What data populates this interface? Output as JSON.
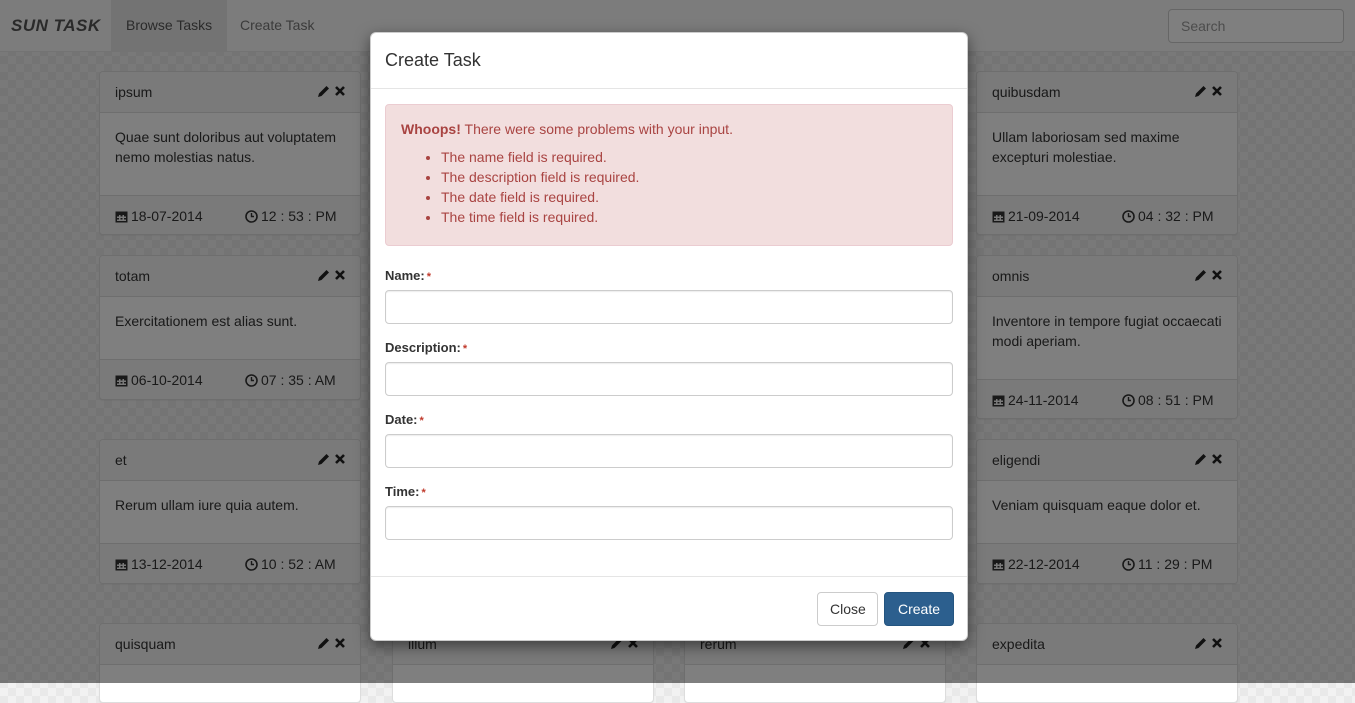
{
  "navbar": {
    "brand": "SUN TASK",
    "links": [
      {
        "label": "Browse Tasks",
        "active": true
      },
      {
        "label": "Create Task",
        "active": false
      }
    ],
    "search_placeholder": "Search"
  },
  "tasks": [
    {
      "title": "ipsum",
      "description": "Quae sunt doloribus aut voluptatem nemo molestias natus.",
      "date": "18-07-2014",
      "time": "12 : 53 : PM"
    },
    {
      "title": "quibusdam",
      "description": "Ullam laboriosam sed maxime excepturi molestiae.",
      "date": "21-09-2014",
      "time": "04 : 32 : PM"
    },
    {
      "title": "totam",
      "description": "Exercitationem est alias sunt.",
      "date": "06-10-2014",
      "time": "07 : 35 : AM"
    },
    {
      "title": "omnis",
      "description": "Inventore in tempore fugiat occaecati modi aperiam.",
      "date": "24-11-2014",
      "time": "08 : 51 : PM"
    },
    {
      "title": "et",
      "description": "Rerum ullam iure quia autem.",
      "date": "13-12-2014",
      "time": "10 : 52 : AM"
    },
    {
      "title": "eligendi",
      "description": "Veniam quisquam eaque dolor et.",
      "date": "22-12-2014",
      "time": "11 : 29 : PM"
    },
    {
      "title": "quisquam"
    },
    {
      "title": "illum"
    },
    {
      "title": "rerum"
    },
    {
      "title": "expedita"
    }
  ],
  "modal": {
    "title": "Create Task",
    "alert": {
      "strong": "Whoops!",
      "message": " There were some problems with your input.",
      "errors": [
        "The name field is required.",
        "The description field is required.",
        "The date field is required.",
        "The time field is required."
      ]
    },
    "fields": {
      "name_label": "Name:",
      "description_label": "Description:",
      "date_label": "Date:",
      "time_label": "Time:",
      "required_mark": "*"
    },
    "close_label": "Close",
    "create_label": "Create"
  },
  "icons": {
    "edit": "pencil-icon",
    "delete": "close-icon",
    "date": "calendar-icon",
    "time": "clock-icon"
  },
  "colors": {
    "primary": "#2c5f8e",
    "alert_bg": "#f2dede",
    "alert_text": "#a94442"
  }
}
